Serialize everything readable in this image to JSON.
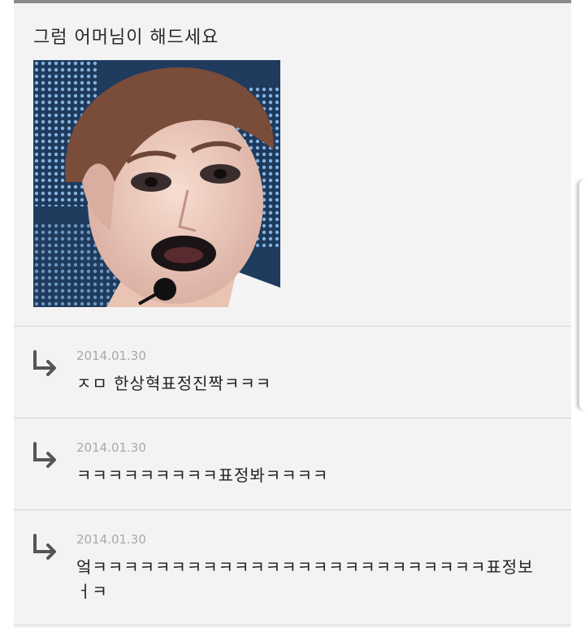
{
  "post": {
    "title": "그럼 어머님이 해드세요",
    "image_icon": "face-photo"
  },
  "replies": [
    {
      "icon": "reply-arrow-icon",
      "date": "2014.01.30",
      "text": "ㅈㅁ 한상혁표정진짝ㅋㅋㅋ"
    },
    {
      "icon": "reply-arrow-icon",
      "date": "2014.01.30",
      "text": "ㅋㅋㅋㅋㅋㅋㅋㅋㅋ표정봐ㅋㅋㅋㅋ"
    },
    {
      "icon": "reply-arrow-icon",
      "date": "2014.01.30",
      "text": "엌ㅋㅋㅋㅋㅋㅋㅋㅋㅋㅋㅋㅋㅋㅋㅋㅋㅋㅋㅋㅋㅋㅋㅋㅋㅋ표정보ㅓㅋ"
    }
  ],
  "colors": {
    "background": "#f3f3f3",
    "divider": "#d6d6d6",
    "date": "#a9a9a9",
    "text": "#222222",
    "arrow": "#555555"
  }
}
